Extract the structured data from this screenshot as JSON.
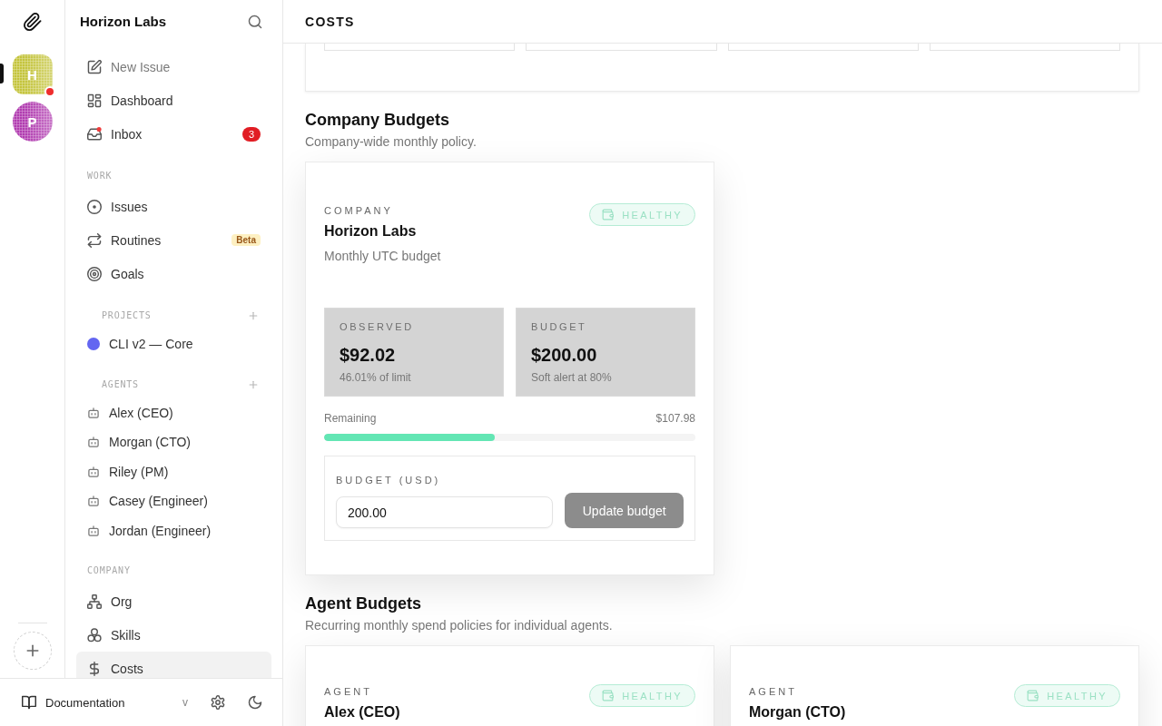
{
  "rail": {
    "companies": [
      {
        "initial": "H",
        "selected": true,
        "alert": true,
        "color": "#c4c43c"
      },
      {
        "initial": "P",
        "selected": false,
        "alert": false,
        "color": "#b13cb0"
      }
    ]
  },
  "sidebar": {
    "title": "Horizon Labs",
    "sections": [
      {
        "kind": "plain",
        "items": [
          {
            "label": "New Issue",
            "kind": "action",
            "selected": false
          },
          {
            "label": "Dashboard",
            "kind": "link",
            "selected": false
          },
          {
            "label": "Inbox",
            "kind": "link",
            "selected": false,
            "count": "3"
          }
        ]
      },
      {
        "kind": "plain",
        "heading": "WORK",
        "items": [
          {
            "label": "Issues",
            "kind": "link",
            "selected": false
          },
          {
            "label": "Routines",
            "kind": "link",
            "selected": false,
            "tag": "Beta"
          },
          {
            "label": "Goals",
            "kind": "link",
            "selected": false
          }
        ]
      },
      {
        "kind": "collapsible",
        "heading": "PROJECTS",
        "items": [
          {
            "label": "CLI v2 — Core",
            "kind": "project",
            "selected": false,
            "color": "#6366f1"
          }
        ]
      },
      {
        "kind": "collapsible",
        "heading": "AGENTS",
        "items": [
          {
            "label": "Alex (CEO)",
            "kind": "agent",
            "selected": false
          },
          {
            "label": "Morgan (CTO)",
            "kind": "agent",
            "selected": false
          },
          {
            "label": "Riley (PM)",
            "kind": "agent",
            "selected": false
          },
          {
            "label": "Casey (Engineer)",
            "kind": "agent",
            "selected": false
          },
          {
            "label": "Jordan (Engineer)",
            "kind": "agent",
            "selected": false
          }
        ]
      },
      {
        "kind": "plain",
        "heading": "COMPANY",
        "items": [
          {
            "label": "Org",
            "kind": "link",
            "selected": false
          },
          {
            "label": "Skills",
            "kind": "link",
            "selected": false
          },
          {
            "label": "Costs",
            "kind": "link",
            "selected": true
          }
        ]
      }
    ]
  },
  "footer": {
    "docs_label": "Documentation",
    "version": "v"
  },
  "main": {
    "title": "COSTS",
    "company_budgets": {
      "title": "Company Budgets",
      "subtitle": "Company-wide monthly policy.",
      "cards": [
        {
          "scope_label": "COMPANY",
          "name": "Horizon Labs",
          "period": "Monthly UTC budget",
          "badge": {
            "kind": "healthy",
            "label": "HEALTHY"
          },
          "stats": [
            {
              "label": "OBSERVED",
              "value": "$92.02",
              "note": "46.01% of limit"
            },
            {
              "label": "BUDGET",
              "value": "$200.00",
              "note": "Soft alert at 80%"
            }
          ],
          "remaining": {
            "label": "Remaining",
            "amount": "$107.98",
            "level": 0.46
          },
          "form": {
            "label": "BUDGET (USD)",
            "value": "200.00",
            "button": "Update budget"
          }
        }
      ]
    },
    "agent_budgets": {
      "title": "Agent Budgets",
      "subtitle": "Recurring monthly spend policies for individual agents.",
      "cards": [
        {
          "scope_label": "AGENT",
          "name": "Alex (CEO)",
          "badge": {
            "kind": "healthy",
            "label": "HEALTHY"
          }
        },
        {
          "scope_label": "AGENT",
          "name": "Morgan (CTO)",
          "badge": {
            "kind": "healthy",
            "label": "HEALTHY"
          }
        }
      ]
    }
  }
}
